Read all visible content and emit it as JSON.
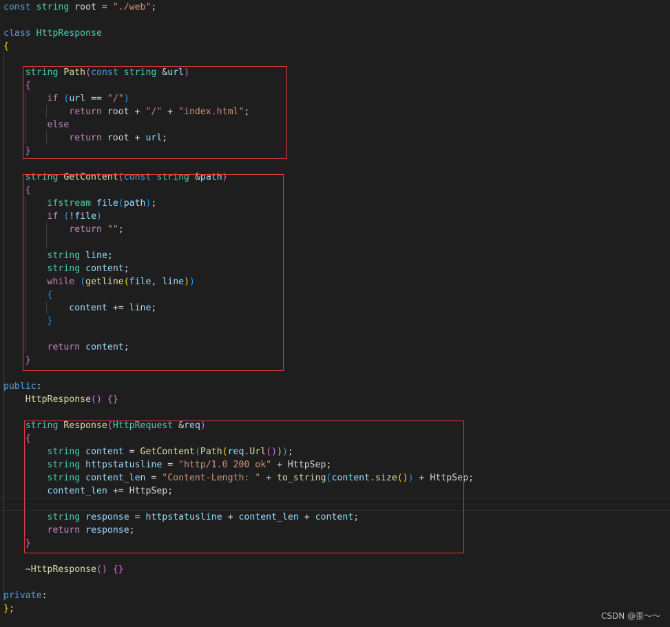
{
  "editor": {
    "language": "cpp",
    "theme": "dark",
    "colors": {
      "background": "#1e1e1e",
      "keyword": "#569cd6",
      "type": "#4ec9b0",
      "function": "#dcdcaa",
      "string": "#ce9178",
      "control": "#c586c0",
      "parameter": "#9cdcfe",
      "annotation_box": "#e03c3c"
    },
    "lines": [
      {
        "tokens": [
          {
            "t": "const ",
            "c": "kw"
          },
          {
            "t": "string",
            "c": "ty"
          },
          {
            "t": " root = ",
            "c": "plain"
          },
          {
            "t": "\"./web\"",
            "c": "str"
          },
          {
            "t": ";",
            "c": "plain"
          }
        ]
      },
      {
        "tokens": []
      },
      {
        "tokens": [
          {
            "t": "class ",
            "c": "kw"
          },
          {
            "t": "HttpResponse",
            "c": "ty"
          }
        ]
      },
      {
        "tokens": [
          {
            "t": "{",
            "c": "br1"
          }
        ]
      },
      {
        "tokens": []
      },
      {
        "tokens": [
          {
            "t": "    ",
            "c": "plain"
          },
          {
            "t": "string",
            "c": "ty"
          },
          {
            "t": " ",
            "c": "plain"
          },
          {
            "t": "Path",
            "c": "fn"
          },
          {
            "t": "(",
            "c": "br2"
          },
          {
            "t": "const ",
            "c": "kw"
          },
          {
            "t": "string",
            "c": "ty"
          },
          {
            "t": " &",
            "c": "plain"
          },
          {
            "t": "url",
            "c": "par"
          },
          {
            "t": ")",
            "c": "br2"
          }
        ]
      },
      {
        "tokens": [
          {
            "t": "    ",
            "c": "plain"
          },
          {
            "t": "{",
            "c": "br2"
          }
        ]
      },
      {
        "tokens": [
          {
            "t": "        ",
            "c": "plain"
          },
          {
            "t": "if",
            "c": "ctrl"
          },
          {
            "t": " ",
            "c": "plain"
          },
          {
            "t": "(",
            "c": "br3"
          },
          {
            "t": "url",
            "c": "par"
          },
          {
            "t": " == ",
            "c": "plain"
          },
          {
            "t": "\"/\"",
            "c": "str"
          },
          {
            "t": ")",
            "c": "br3"
          }
        ]
      },
      {
        "tokens": [
          {
            "t": "            ",
            "c": "plain"
          },
          {
            "t": "return",
            "c": "ctrl"
          },
          {
            "t": " root + ",
            "c": "plain"
          },
          {
            "t": "\"/\"",
            "c": "str"
          },
          {
            "t": " + ",
            "c": "plain"
          },
          {
            "t": "\"index.html\"",
            "c": "str"
          },
          {
            "t": ";",
            "c": "plain"
          }
        ]
      },
      {
        "tokens": [
          {
            "t": "        ",
            "c": "plain"
          },
          {
            "t": "else",
            "c": "ctrl"
          }
        ]
      },
      {
        "tokens": [
          {
            "t": "            ",
            "c": "plain"
          },
          {
            "t": "return",
            "c": "ctrl"
          },
          {
            "t": " root + ",
            "c": "plain"
          },
          {
            "t": "url",
            "c": "par"
          },
          {
            "t": ";",
            "c": "plain"
          }
        ]
      },
      {
        "tokens": [
          {
            "t": "    ",
            "c": "plain"
          },
          {
            "t": "}",
            "c": "br2"
          }
        ]
      },
      {
        "tokens": []
      },
      {
        "tokens": [
          {
            "t": "    ",
            "c": "plain"
          },
          {
            "t": "string",
            "c": "ty"
          },
          {
            "t": " ",
            "c": "plain"
          },
          {
            "t": "GetContent",
            "c": "fn"
          },
          {
            "t": "(",
            "c": "br2"
          },
          {
            "t": "const ",
            "c": "kw"
          },
          {
            "t": "string",
            "c": "ty"
          },
          {
            "t": " &",
            "c": "plain"
          },
          {
            "t": "path",
            "c": "par"
          },
          {
            "t": ")",
            "c": "br2"
          }
        ]
      },
      {
        "tokens": [
          {
            "t": "    ",
            "c": "plain"
          },
          {
            "t": "{",
            "c": "br2"
          }
        ]
      },
      {
        "tokens": [
          {
            "t": "        ",
            "c": "plain"
          },
          {
            "t": "ifstream",
            "c": "ty"
          },
          {
            "t": " ",
            "c": "plain"
          },
          {
            "t": "file",
            "c": "par"
          },
          {
            "t": "(",
            "c": "br3"
          },
          {
            "t": "path",
            "c": "par"
          },
          {
            "t": ")",
            "c": "br3"
          },
          {
            "t": ";",
            "c": "plain"
          }
        ]
      },
      {
        "tokens": [
          {
            "t": "        ",
            "c": "plain"
          },
          {
            "t": "if",
            "c": "ctrl"
          },
          {
            "t": " ",
            "c": "plain"
          },
          {
            "t": "(",
            "c": "br3"
          },
          {
            "t": "!",
            "c": "plain"
          },
          {
            "t": "file",
            "c": "par"
          },
          {
            "t": ")",
            "c": "br3"
          }
        ]
      },
      {
        "tokens": [
          {
            "t": "            ",
            "c": "plain"
          },
          {
            "t": "return",
            "c": "ctrl"
          },
          {
            "t": " ",
            "c": "plain"
          },
          {
            "t": "\"\"",
            "c": "str"
          },
          {
            "t": ";",
            "c": "plain"
          }
        ]
      },
      {
        "tokens": []
      },
      {
        "tokens": [
          {
            "t": "        ",
            "c": "plain"
          },
          {
            "t": "string",
            "c": "ty"
          },
          {
            "t": " ",
            "c": "plain"
          },
          {
            "t": "line",
            "c": "par"
          },
          {
            "t": ";",
            "c": "plain"
          }
        ]
      },
      {
        "tokens": [
          {
            "t": "        ",
            "c": "plain"
          },
          {
            "t": "string",
            "c": "ty"
          },
          {
            "t": " ",
            "c": "plain"
          },
          {
            "t": "content",
            "c": "par"
          },
          {
            "t": ";",
            "c": "plain"
          }
        ]
      },
      {
        "tokens": [
          {
            "t": "        ",
            "c": "plain"
          },
          {
            "t": "while",
            "c": "ctrl"
          },
          {
            "t": " ",
            "c": "plain"
          },
          {
            "t": "(",
            "c": "br3"
          },
          {
            "t": "getline",
            "c": "fn"
          },
          {
            "t": "(",
            "c": "br1"
          },
          {
            "t": "file",
            "c": "par"
          },
          {
            "t": ", ",
            "c": "plain"
          },
          {
            "t": "line",
            "c": "par"
          },
          {
            "t": ")",
            "c": "br1"
          },
          {
            "t": ")",
            "c": "br3"
          }
        ]
      },
      {
        "tokens": [
          {
            "t": "        ",
            "c": "plain"
          },
          {
            "t": "{",
            "c": "br3"
          }
        ]
      },
      {
        "tokens": [
          {
            "t": "            ",
            "c": "plain"
          },
          {
            "t": "content",
            "c": "par"
          },
          {
            "t": " += ",
            "c": "plain"
          },
          {
            "t": "line",
            "c": "par"
          },
          {
            "t": ";",
            "c": "plain"
          }
        ]
      },
      {
        "tokens": [
          {
            "t": "        ",
            "c": "plain"
          },
          {
            "t": "}",
            "c": "br3"
          }
        ]
      },
      {
        "tokens": []
      },
      {
        "tokens": [
          {
            "t": "        ",
            "c": "plain"
          },
          {
            "t": "return",
            "c": "ctrl"
          },
          {
            "t": " ",
            "c": "plain"
          },
          {
            "t": "content",
            "c": "par"
          },
          {
            "t": ";",
            "c": "plain"
          }
        ]
      },
      {
        "tokens": [
          {
            "t": "    ",
            "c": "plain"
          },
          {
            "t": "}",
            "c": "br2"
          }
        ]
      },
      {
        "tokens": []
      },
      {
        "tokens": [
          {
            "t": "public",
            "c": "kw"
          },
          {
            "t": ":",
            "c": "plain"
          }
        ]
      },
      {
        "tokens": [
          {
            "t": "    ",
            "c": "plain"
          },
          {
            "t": "HttpResponse",
            "c": "fn"
          },
          {
            "t": "()",
            "c": "br2"
          },
          {
            "t": " ",
            "c": "plain"
          },
          {
            "t": "{}",
            "c": "br2"
          }
        ]
      },
      {
        "tokens": []
      },
      {
        "tokens": [
          {
            "t": "    ",
            "c": "plain"
          },
          {
            "t": "string",
            "c": "ty"
          },
          {
            "t": " ",
            "c": "plain"
          },
          {
            "t": "Response",
            "c": "fn"
          },
          {
            "t": "(",
            "c": "br2"
          },
          {
            "t": "HttpRequest",
            "c": "ty"
          },
          {
            "t": " &",
            "c": "plain"
          },
          {
            "t": "req",
            "c": "par"
          },
          {
            "t": ")",
            "c": "br2"
          }
        ]
      },
      {
        "tokens": [
          {
            "t": "    ",
            "c": "plain"
          },
          {
            "t": "{",
            "c": "br2"
          }
        ]
      },
      {
        "tokens": [
          {
            "t": "        ",
            "c": "plain"
          },
          {
            "t": "string",
            "c": "ty"
          },
          {
            "t": " ",
            "c": "plain"
          },
          {
            "t": "content",
            "c": "par"
          },
          {
            "t": " = ",
            "c": "plain"
          },
          {
            "t": "GetContent",
            "c": "fn"
          },
          {
            "t": "(",
            "c": "br3"
          },
          {
            "t": "Path",
            "c": "fn"
          },
          {
            "t": "(",
            "c": "br1"
          },
          {
            "t": "req",
            "c": "par"
          },
          {
            "t": ".",
            "c": "plain"
          },
          {
            "t": "Url",
            "c": "fn"
          },
          {
            "t": "()",
            "c": "br2"
          },
          {
            "t": ")",
            "c": "br1"
          },
          {
            "t": ")",
            "c": "br3"
          },
          {
            "t": ";",
            "c": "plain"
          }
        ]
      },
      {
        "tokens": [
          {
            "t": "        ",
            "c": "plain"
          },
          {
            "t": "string",
            "c": "ty"
          },
          {
            "t": " ",
            "c": "plain"
          },
          {
            "t": "httpstatusline",
            "c": "par"
          },
          {
            "t": " = ",
            "c": "plain"
          },
          {
            "t": "\"http/1.0 200 ok\"",
            "c": "str"
          },
          {
            "t": " + HttpSep;",
            "c": "plain"
          }
        ]
      },
      {
        "tokens": [
          {
            "t": "        ",
            "c": "plain"
          },
          {
            "t": "string",
            "c": "ty"
          },
          {
            "t": " ",
            "c": "plain"
          },
          {
            "t": "content_len",
            "c": "par"
          },
          {
            "t": " = ",
            "c": "plain"
          },
          {
            "t": "\"Content-Length: \"",
            "c": "str"
          },
          {
            "t": " + ",
            "c": "plain"
          },
          {
            "t": "to_string",
            "c": "fn"
          },
          {
            "t": "(",
            "c": "br3"
          },
          {
            "t": "content",
            "c": "par"
          },
          {
            "t": ".",
            "c": "plain"
          },
          {
            "t": "size",
            "c": "fn"
          },
          {
            "t": "()",
            "c": "br1"
          },
          {
            "t": ")",
            "c": "br3"
          },
          {
            "t": " + HttpSep;",
            "c": "plain"
          }
        ]
      },
      {
        "tokens": [
          {
            "t": "        ",
            "c": "plain"
          },
          {
            "t": "content_len",
            "c": "par"
          },
          {
            "t": " += HttpSep;",
            "c": "plain"
          }
        ]
      },
      {
        "tokens": []
      },
      {
        "tokens": [
          {
            "t": "        ",
            "c": "plain"
          },
          {
            "t": "string",
            "c": "ty"
          },
          {
            "t": " ",
            "c": "plain"
          },
          {
            "t": "response",
            "c": "par"
          },
          {
            "t": " = ",
            "c": "plain"
          },
          {
            "t": "httpstatusline",
            "c": "par"
          },
          {
            "t": " + ",
            "c": "plain"
          },
          {
            "t": "content_len",
            "c": "par"
          },
          {
            "t": " + ",
            "c": "plain"
          },
          {
            "t": "content",
            "c": "par"
          },
          {
            "t": ";",
            "c": "plain"
          }
        ]
      },
      {
        "tokens": [
          {
            "t": "        ",
            "c": "plain"
          },
          {
            "t": "return",
            "c": "ctrl"
          },
          {
            "t": " ",
            "c": "plain"
          },
          {
            "t": "response",
            "c": "par"
          },
          {
            "t": ";",
            "c": "plain"
          }
        ]
      },
      {
        "tokens": [
          {
            "t": "    ",
            "c": "plain"
          },
          {
            "t": "}",
            "c": "br2"
          }
        ]
      },
      {
        "tokens": []
      },
      {
        "tokens": [
          {
            "t": "    ~",
            "c": "plain"
          },
          {
            "t": "HttpResponse",
            "c": "fn"
          },
          {
            "t": "()",
            "c": "br2"
          },
          {
            "t": " ",
            "c": "plain"
          },
          {
            "t": "{}",
            "c": "br2"
          }
        ]
      },
      {
        "tokens": []
      },
      {
        "tokens": [
          {
            "t": "private",
            "c": "kw"
          },
          {
            "t": ":",
            "c": "plain"
          }
        ]
      },
      {
        "tokens": [
          {
            "t": "};",
            "c": "br1"
          }
        ]
      }
    ]
  },
  "watermark": {
    "text": "CSDN @歪～～"
  }
}
